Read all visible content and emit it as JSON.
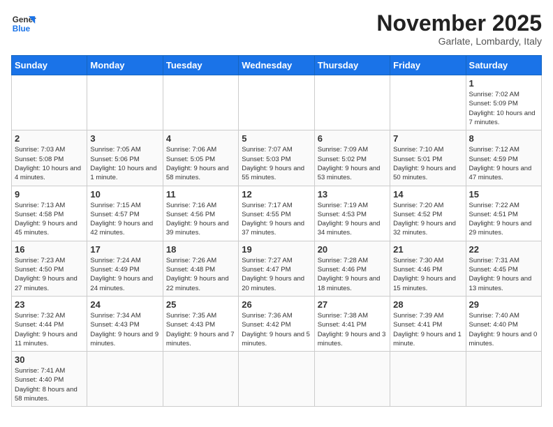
{
  "logo": {
    "text_general": "General",
    "text_blue": "Blue"
  },
  "header": {
    "month": "November 2025",
    "location": "Garlate, Lombardy, Italy"
  },
  "weekdays": [
    "Sunday",
    "Monday",
    "Tuesday",
    "Wednesday",
    "Thursday",
    "Friday",
    "Saturday"
  ],
  "weeks": [
    [
      {
        "day": "",
        "info": ""
      },
      {
        "day": "",
        "info": ""
      },
      {
        "day": "",
        "info": ""
      },
      {
        "day": "",
        "info": ""
      },
      {
        "day": "",
        "info": ""
      },
      {
        "day": "",
        "info": ""
      },
      {
        "day": "1",
        "info": "Sunrise: 7:02 AM\nSunset: 5:09 PM\nDaylight: 10 hours and 7 minutes."
      }
    ],
    [
      {
        "day": "2",
        "info": "Sunrise: 7:03 AM\nSunset: 5:08 PM\nDaylight: 10 hours and 4 minutes."
      },
      {
        "day": "3",
        "info": "Sunrise: 7:05 AM\nSunset: 5:06 PM\nDaylight: 10 hours and 1 minute."
      },
      {
        "day": "4",
        "info": "Sunrise: 7:06 AM\nSunset: 5:05 PM\nDaylight: 9 hours and 58 minutes."
      },
      {
        "day": "5",
        "info": "Sunrise: 7:07 AM\nSunset: 5:03 PM\nDaylight: 9 hours and 55 minutes."
      },
      {
        "day": "6",
        "info": "Sunrise: 7:09 AM\nSunset: 5:02 PM\nDaylight: 9 hours and 53 minutes."
      },
      {
        "day": "7",
        "info": "Sunrise: 7:10 AM\nSunset: 5:01 PM\nDaylight: 9 hours and 50 minutes."
      },
      {
        "day": "8",
        "info": "Sunrise: 7:12 AM\nSunset: 4:59 PM\nDaylight: 9 hours and 47 minutes."
      }
    ],
    [
      {
        "day": "9",
        "info": "Sunrise: 7:13 AM\nSunset: 4:58 PM\nDaylight: 9 hours and 45 minutes."
      },
      {
        "day": "10",
        "info": "Sunrise: 7:15 AM\nSunset: 4:57 PM\nDaylight: 9 hours and 42 minutes."
      },
      {
        "day": "11",
        "info": "Sunrise: 7:16 AM\nSunset: 4:56 PM\nDaylight: 9 hours and 39 minutes."
      },
      {
        "day": "12",
        "info": "Sunrise: 7:17 AM\nSunset: 4:55 PM\nDaylight: 9 hours and 37 minutes."
      },
      {
        "day": "13",
        "info": "Sunrise: 7:19 AM\nSunset: 4:53 PM\nDaylight: 9 hours and 34 minutes."
      },
      {
        "day": "14",
        "info": "Sunrise: 7:20 AM\nSunset: 4:52 PM\nDaylight: 9 hours and 32 minutes."
      },
      {
        "day": "15",
        "info": "Sunrise: 7:22 AM\nSunset: 4:51 PM\nDaylight: 9 hours and 29 minutes."
      }
    ],
    [
      {
        "day": "16",
        "info": "Sunrise: 7:23 AM\nSunset: 4:50 PM\nDaylight: 9 hours and 27 minutes."
      },
      {
        "day": "17",
        "info": "Sunrise: 7:24 AM\nSunset: 4:49 PM\nDaylight: 9 hours and 24 minutes."
      },
      {
        "day": "18",
        "info": "Sunrise: 7:26 AM\nSunset: 4:48 PM\nDaylight: 9 hours and 22 minutes."
      },
      {
        "day": "19",
        "info": "Sunrise: 7:27 AM\nSunset: 4:47 PM\nDaylight: 9 hours and 20 minutes."
      },
      {
        "day": "20",
        "info": "Sunrise: 7:28 AM\nSunset: 4:46 PM\nDaylight: 9 hours and 18 minutes."
      },
      {
        "day": "21",
        "info": "Sunrise: 7:30 AM\nSunset: 4:46 PM\nDaylight: 9 hours and 15 minutes."
      },
      {
        "day": "22",
        "info": "Sunrise: 7:31 AM\nSunset: 4:45 PM\nDaylight: 9 hours and 13 minutes."
      }
    ],
    [
      {
        "day": "23",
        "info": "Sunrise: 7:32 AM\nSunset: 4:44 PM\nDaylight: 9 hours and 11 minutes."
      },
      {
        "day": "24",
        "info": "Sunrise: 7:34 AM\nSunset: 4:43 PM\nDaylight: 9 hours and 9 minutes."
      },
      {
        "day": "25",
        "info": "Sunrise: 7:35 AM\nSunset: 4:43 PM\nDaylight: 9 hours and 7 minutes."
      },
      {
        "day": "26",
        "info": "Sunrise: 7:36 AM\nSunset: 4:42 PM\nDaylight: 9 hours and 5 minutes."
      },
      {
        "day": "27",
        "info": "Sunrise: 7:38 AM\nSunset: 4:41 PM\nDaylight: 9 hours and 3 minutes."
      },
      {
        "day": "28",
        "info": "Sunrise: 7:39 AM\nSunset: 4:41 PM\nDaylight: 9 hours and 1 minute."
      },
      {
        "day": "29",
        "info": "Sunrise: 7:40 AM\nSunset: 4:40 PM\nDaylight: 9 hours and 0 minutes."
      }
    ],
    [
      {
        "day": "30",
        "info": "Sunrise: 7:41 AM\nSunset: 4:40 PM\nDaylight: 8 hours and 58 minutes."
      },
      {
        "day": "",
        "info": ""
      },
      {
        "day": "",
        "info": ""
      },
      {
        "day": "",
        "info": ""
      },
      {
        "day": "",
        "info": ""
      },
      {
        "day": "",
        "info": ""
      },
      {
        "day": "",
        "info": ""
      }
    ]
  ]
}
